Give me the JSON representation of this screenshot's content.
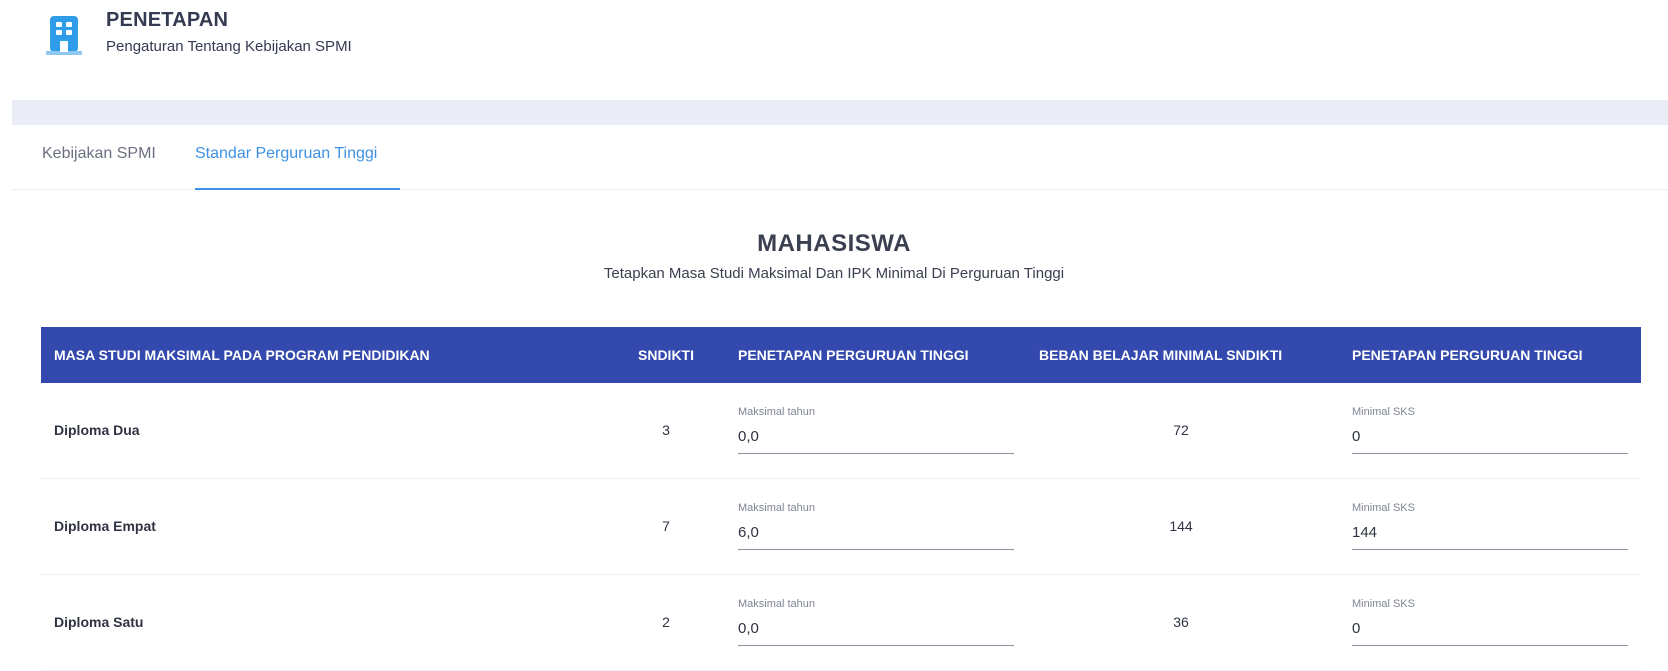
{
  "header": {
    "title": "PENETAPAN",
    "subtitle": "Pengaturan Tentang Kebijakan SPMI",
    "icon": "building-icon",
    "icon_color": "#2e9ce8"
  },
  "tabs": [
    {
      "label": "Kebijakan SPMI",
      "active": false
    },
    {
      "label": "Standar Perguruan Tinggi",
      "active": true
    }
  ],
  "accent_color": "#3e91e4",
  "section": {
    "title": "MAHASISWA",
    "subtitle": "Tetapkan Masa Studi Maksimal Dan IPK Minimal Di Perguruan Tinggi"
  },
  "table": {
    "header_color": "#3349ad",
    "columns": [
      "MASA STUDI MAKSIMAL PADA PROGRAM PENDIDIKAN",
      "SNDIKTI",
      "PENETAPAN PERGURUAN TINGGI",
      "BEBAN BELAJAR MINIMAL SNDIKTI",
      "PENETAPAN PERGURUAN TINGGI"
    ],
    "rows": [
      {
        "program": "Diploma Dua",
        "sndikti": "3",
        "max_year_label": "Maksimal tahun",
        "max_year_value": "0,0",
        "beban": "72",
        "min_sks_label": "Minimal SKS",
        "min_sks_value": "0"
      },
      {
        "program": "Diploma Empat",
        "sndikti": "7",
        "max_year_label": "Maksimal tahun",
        "max_year_value": "6,0",
        "beban": "144",
        "min_sks_label": "Minimal SKS",
        "min_sks_value": "144"
      },
      {
        "program": "Diploma Satu",
        "sndikti": "2",
        "max_year_label": "Maksimal tahun",
        "max_year_value": "0,0",
        "beban": "36",
        "min_sks_label": "Minimal SKS",
        "min_sks_value": "0"
      }
    ]
  }
}
